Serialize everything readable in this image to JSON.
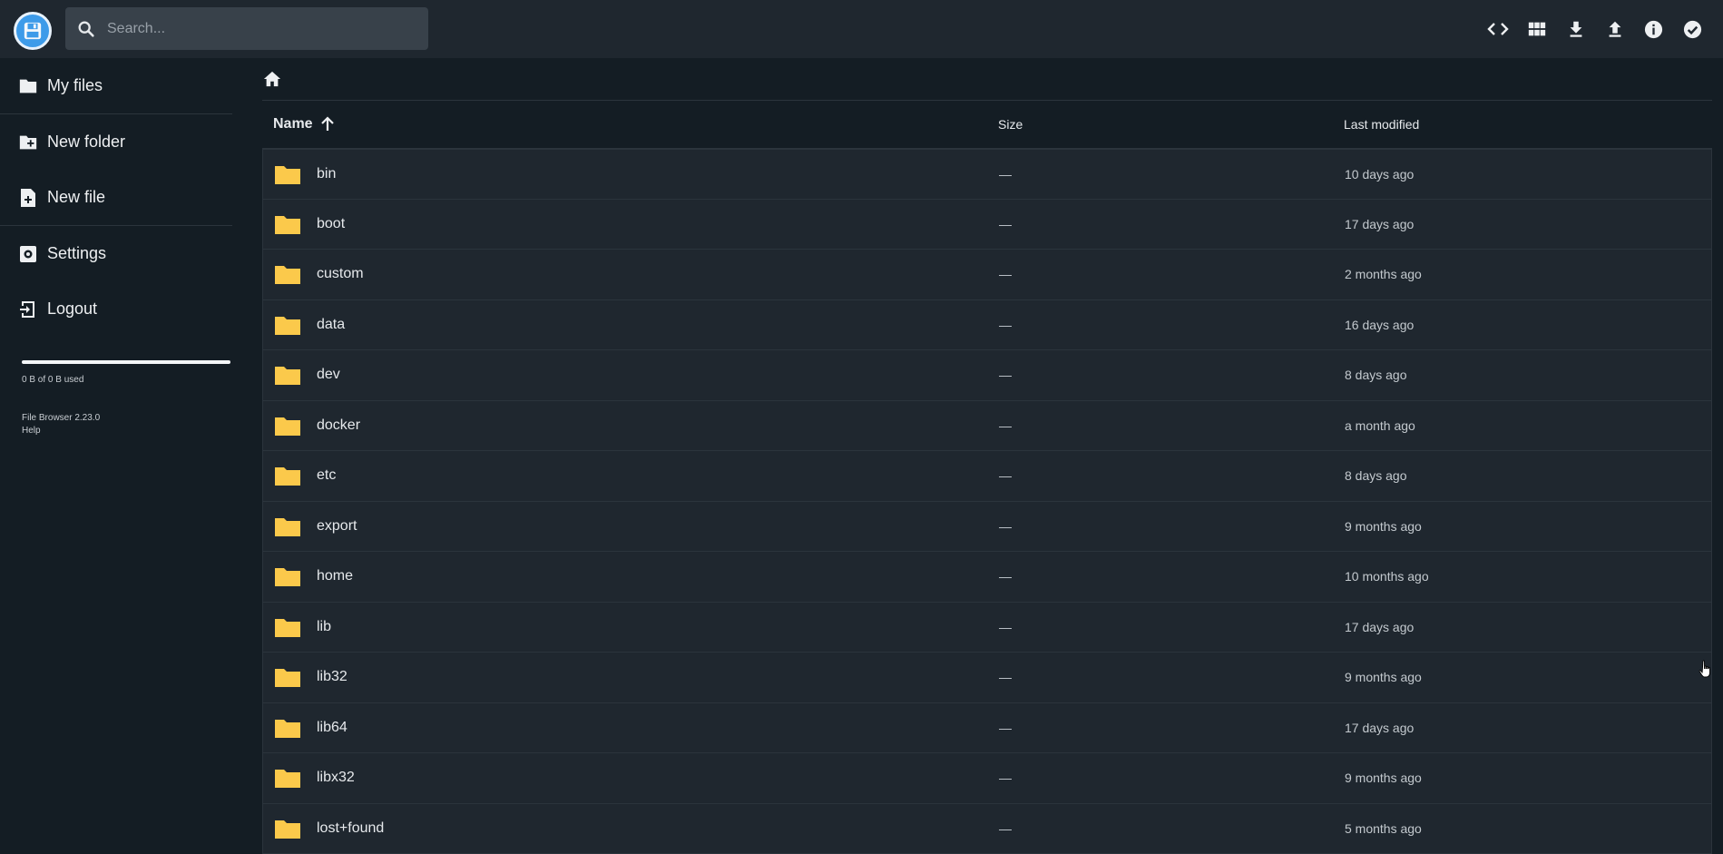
{
  "header": {
    "search_placeholder": "Search...",
    "actions": [
      "code-icon",
      "grid-view-icon",
      "download-icon",
      "upload-icon",
      "info-icon",
      "select-check-icon"
    ]
  },
  "sidebar": {
    "items": [
      {
        "label": "My files",
        "icon": "folder-icon"
      },
      {
        "label": "New folder",
        "icon": "create-folder-icon"
      },
      {
        "label": "New file",
        "icon": "note-add-icon"
      },
      {
        "label": "Settings",
        "icon": "settings-icon"
      },
      {
        "label": "Logout",
        "icon": "logout-icon"
      }
    ],
    "usage_text": "0 B of 0 B used",
    "usage_fraction": 1.0,
    "version": "File Browser 2.23.0",
    "help": "Help"
  },
  "main": {
    "columns": {
      "name": "Name",
      "size": "Size",
      "modified": "Last modified"
    },
    "rows": [
      {
        "name": "bin",
        "size": "—",
        "modified": "10 days ago"
      },
      {
        "name": "boot",
        "size": "—",
        "modified": "17 days ago"
      },
      {
        "name": "custom",
        "size": "—",
        "modified": "2 months ago"
      },
      {
        "name": "data",
        "size": "—",
        "modified": "16 days ago"
      },
      {
        "name": "dev",
        "size": "—",
        "modified": "8 days ago"
      },
      {
        "name": "docker",
        "size": "—",
        "modified": "a month ago"
      },
      {
        "name": "etc",
        "size": "—",
        "modified": "8 days ago"
      },
      {
        "name": "export",
        "size": "—",
        "modified": "9 months ago"
      },
      {
        "name": "home",
        "size": "—",
        "modified": "10 months ago"
      },
      {
        "name": "lib",
        "size": "—",
        "modified": "17 days ago"
      },
      {
        "name": "lib32",
        "size": "—",
        "modified": "9 months ago"
      },
      {
        "name": "lib64",
        "size": "—",
        "modified": "17 days ago"
      },
      {
        "name": "libx32",
        "size": "—",
        "modified": "9 months ago"
      },
      {
        "name": "lost+found",
        "size": "—",
        "modified": "5 months ago"
      }
    ]
  },
  "colors": {
    "accent": "#3d9be9",
    "folder": "#fbc94b",
    "header_bg": "#1f272f",
    "page_bg": "#141d24"
  }
}
